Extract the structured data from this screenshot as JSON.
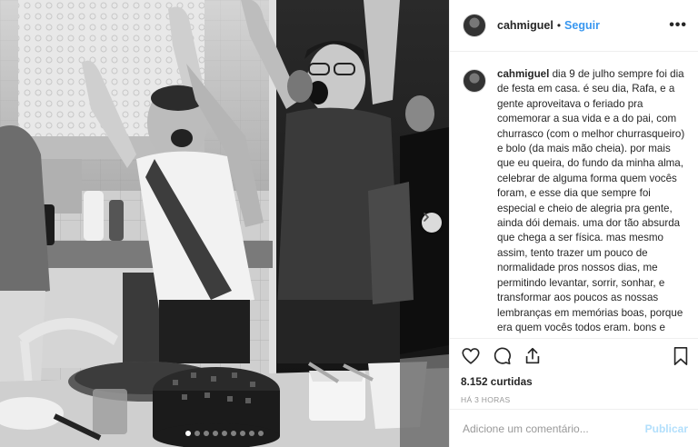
{
  "post": {
    "username": "cahmiguel",
    "separator": "•",
    "follow_label": "Seguir",
    "more_icon": "•••",
    "caption": "dia 9 de julho sempre foi dia de festa em casa. é seu dia, Rafa, e a gente aproveitava o feriado pra comemorar a sua vida e a do pai, com churrasco (com o melhor churrasqueiro) e bolo (da mais mão cheia). por mais que eu queira, do fundo da minha alma, celebrar de alguma forma quem vocês foram, e esse dia que sempre foi especial e cheio de alegria pra gente, ainda dói demais. uma dor tão absurda que chega a ser física. mas mesmo assim, tento trazer um pouco de normalidade pros nossos dias, me permitindo levantar, sorrir, sonhar, e transformar aos poucos as nossas lembranças em memórias boas, porque era quem vocês todos eram. bons e justos. é nisso que tento me",
    "likes": "8.152 curtidas",
    "time": "HÁ 3 HORAS"
  },
  "comment": {
    "placeholder": "Adicione um comentário...",
    "publish_label": "Publicar"
  },
  "carousel": {
    "slide_count": 9,
    "active_index": 0
  },
  "colors": {
    "link_blue": "#3897f0",
    "publish_disabled": "#b2dffc",
    "border": "#efefef",
    "muted": "#999999"
  },
  "icons": [
    "heart-icon",
    "comment-icon",
    "share-icon",
    "bookmark-icon",
    "chevron-right-icon",
    "more-options-icon"
  ]
}
